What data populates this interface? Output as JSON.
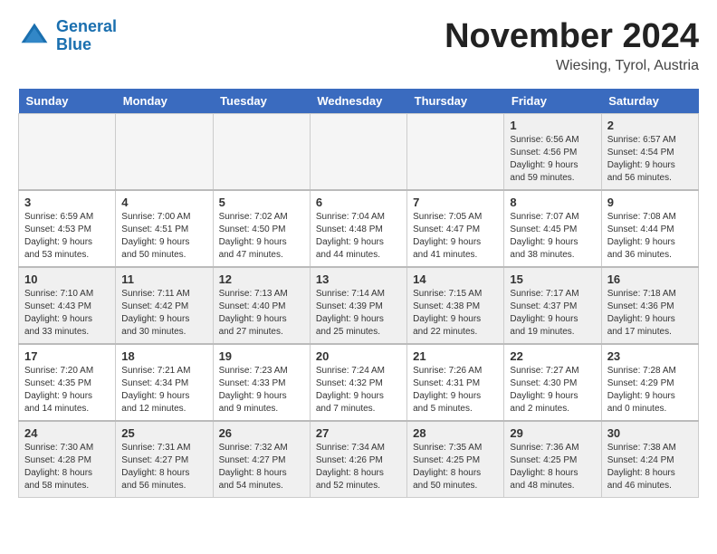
{
  "header": {
    "logo_line1": "General",
    "logo_line2": "Blue",
    "month": "November 2024",
    "location": "Wiesing, Tyrol, Austria"
  },
  "weekdays": [
    "Sunday",
    "Monday",
    "Tuesday",
    "Wednesday",
    "Thursday",
    "Friday",
    "Saturday"
  ],
  "weeks": [
    [
      {
        "day": "",
        "empty": true
      },
      {
        "day": "",
        "empty": true
      },
      {
        "day": "",
        "empty": true
      },
      {
        "day": "",
        "empty": true
      },
      {
        "day": "",
        "empty": true
      },
      {
        "day": "1",
        "info": "Sunrise: 6:56 AM\nSunset: 4:56 PM\nDaylight: 9 hours and 59 minutes."
      },
      {
        "day": "2",
        "info": "Sunrise: 6:57 AM\nSunset: 4:54 PM\nDaylight: 9 hours and 56 minutes."
      }
    ],
    [
      {
        "day": "3",
        "info": "Sunrise: 6:59 AM\nSunset: 4:53 PM\nDaylight: 9 hours and 53 minutes."
      },
      {
        "day": "4",
        "info": "Sunrise: 7:00 AM\nSunset: 4:51 PM\nDaylight: 9 hours and 50 minutes."
      },
      {
        "day": "5",
        "info": "Sunrise: 7:02 AM\nSunset: 4:50 PM\nDaylight: 9 hours and 47 minutes."
      },
      {
        "day": "6",
        "info": "Sunrise: 7:04 AM\nSunset: 4:48 PM\nDaylight: 9 hours and 44 minutes."
      },
      {
        "day": "7",
        "info": "Sunrise: 7:05 AM\nSunset: 4:47 PM\nDaylight: 9 hours and 41 minutes."
      },
      {
        "day": "8",
        "info": "Sunrise: 7:07 AM\nSunset: 4:45 PM\nDaylight: 9 hours and 38 minutes."
      },
      {
        "day": "9",
        "info": "Sunrise: 7:08 AM\nSunset: 4:44 PM\nDaylight: 9 hours and 36 minutes."
      }
    ],
    [
      {
        "day": "10",
        "info": "Sunrise: 7:10 AM\nSunset: 4:43 PM\nDaylight: 9 hours and 33 minutes."
      },
      {
        "day": "11",
        "info": "Sunrise: 7:11 AM\nSunset: 4:42 PM\nDaylight: 9 hours and 30 minutes."
      },
      {
        "day": "12",
        "info": "Sunrise: 7:13 AM\nSunset: 4:40 PM\nDaylight: 9 hours and 27 minutes."
      },
      {
        "day": "13",
        "info": "Sunrise: 7:14 AM\nSunset: 4:39 PM\nDaylight: 9 hours and 25 minutes."
      },
      {
        "day": "14",
        "info": "Sunrise: 7:15 AM\nSunset: 4:38 PM\nDaylight: 9 hours and 22 minutes."
      },
      {
        "day": "15",
        "info": "Sunrise: 7:17 AM\nSunset: 4:37 PM\nDaylight: 9 hours and 19 minutes."
      },
      {
        "day": "16",
        "info": "Sunrise: 7:18 AM\nSunset: 4:36 PM\nDaylight: 9 hours and 17 minutes."
      }
    ],
    [
      {
        "day": "17",
        "info": "Sunrise: 7:20 AM\nSunset: 4:35 PM\nDaylight: 9 hours and 14 minutes."
      },
      {
        "day": "18",
        "info": "Sunrise: 7:21 AM\nSunset: 4:34 PM\nDaylight: 9 hours and 12 minutes."
      },
      {
        "day": "19",
        "info": "Sunrise: 7:23 AM\nSunset: 4:33 PM\nDaylight: 9 hours and 9 minutes."
      },
      {
        "day": "20",
        "info": "Sunrise: 7:24 AM\nSunset: 4:32 PM\nDaylight: 9 hours and 7 minutes."
      },
      {
        "day": "21",
        "info": "Sunrise: 7:26 AM\nSunset: 4:31 PM\nDaylight: 9 hours and 5 minutes."
      },
      {
        "day": "22",
        "info": "Sunrise: 7:27 AM\nSunset: 4:30 PM\nDaylight: 9 hours and 2 minutes."
      },
      {
        "day": "23",
        "info": "Sunrise: 7:28 AM\nSunset: 4:29 PM\nDaylight: 9 hours and 0 minutes."
      }
    ],
    [
      {
        "day": "24",
        "info": "Sunrise: 7:30 AM\nSunset: 4:28 PM\nDaylight: 8 hours and 58 minutes."
      },
      {
        "day": "25",
        "info": "Sunrise: 7:31 AM\nSunset: 4:27 PM\nDaylight: 8 hours and 56 minutes."
      },
      {
        "day": "26",
        "info": "Sunrise: 7:32 AM\nSunset: 4:27 PM\nDaylight: 8 hours and 54 minutes."
      },
      {
        "day": "27",
        "info": "Sunrise: 7:34 AM\nSunset: 4:26 PM\nDaylight: 8 hours and 52 minutes."
      },
      {
        "day": "28",
        "info": "Sunrise: 7:35 AM\nSunset: 4:25 PM\nDaylight: 8 hours and 50 minutes."
      },
      {
        "day": "29",
        "info": "Sunrise: 7:36 AM\nSunset: 4:25 PM\nDaylight: 8 hours and 48 minutes."
      },
      {
        "day": "30",
        "info": "Sunrise: 7:38 AM\nSunset: 4:24 PM\nDaylight: 8 hours and 46 minutes."
      }
    ]
  ]
}
